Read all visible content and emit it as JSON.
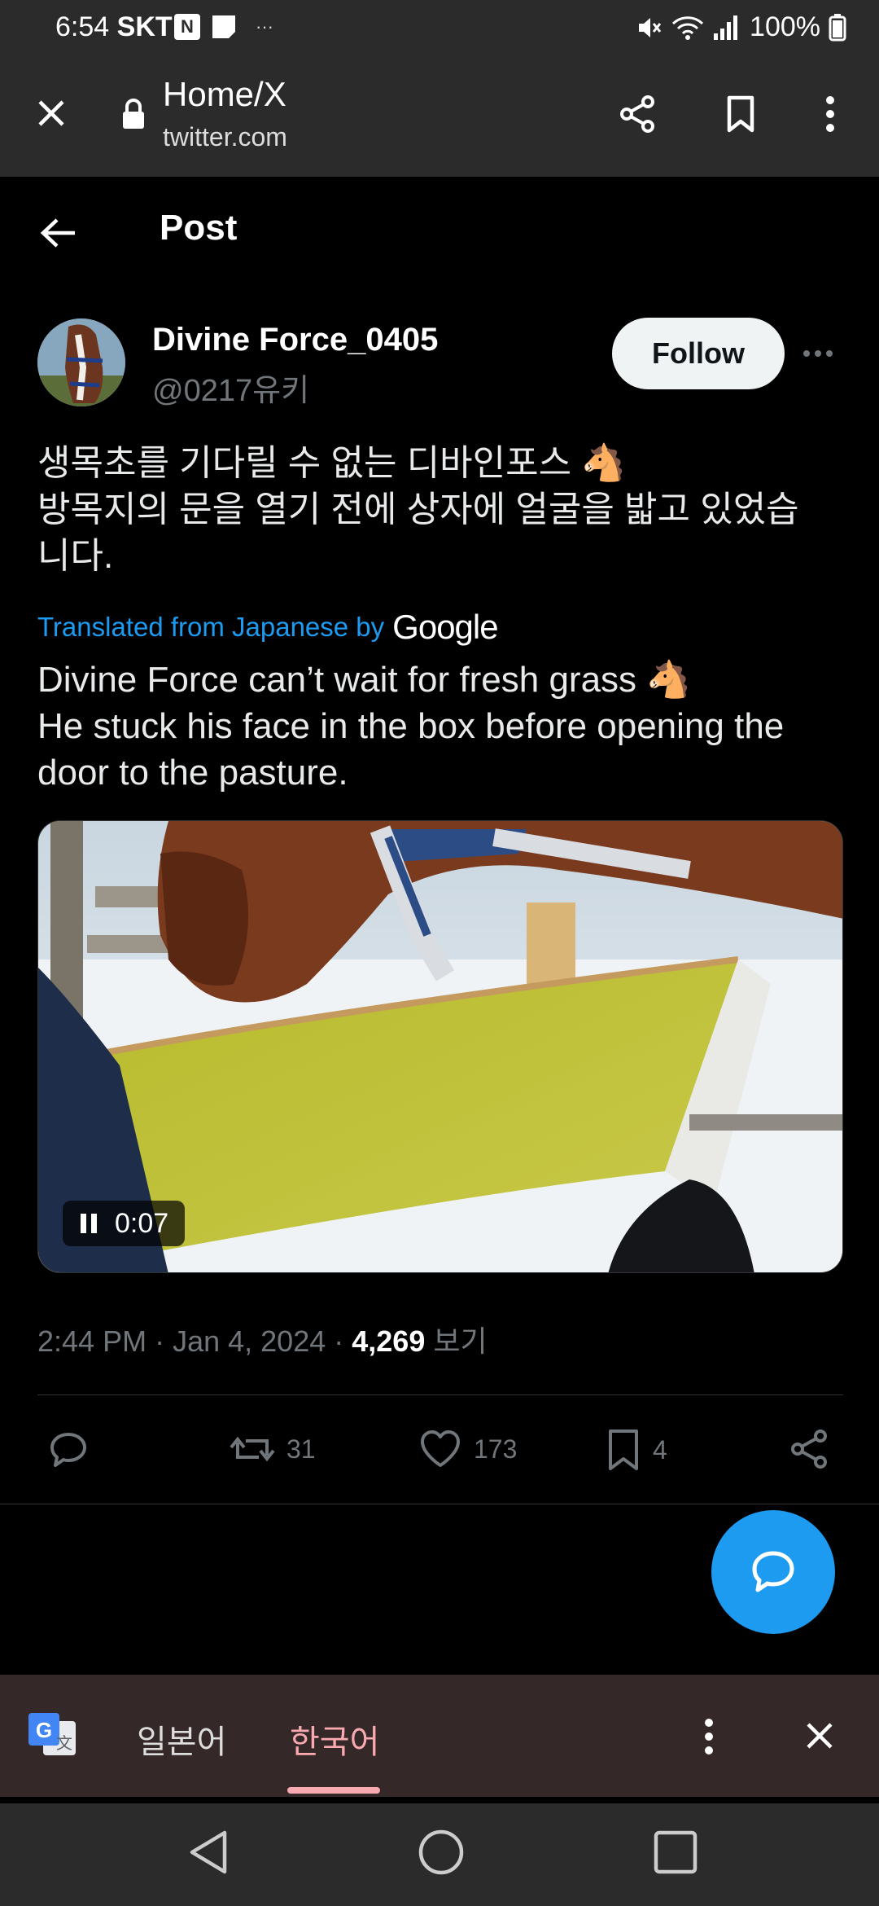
{
  "status": {
    "time": "6:54",
    "carrier": "SKT",
    "notif_icon_letter": "N",
    "battery": "100%"
  },
  "browser": {
    "title": "Home/X",
    "host": "twitter.com"
  },
  "header": {
    "title": "Post"
  },
  "author": {
    "name": "Divine Force_0405",
    "handle": "@0217유키",
    "follow_label": "Follow"
  },
  "tweet": {
    "text_lines": [
      "생목초를 기다릴 수 없는 디바인포스 🐴",
      "방목지의 문을 열기 전에 상자에 얼굴을 밟고 있었습",
      "니다."
    ],
    "translated_label": "Translated from Japanese by",
    "translated_provider": "Google",
    "translation_lines": [
      "Divine Force can’t wait for fresh grass 🐴",
      "He stuck his face in the box before opening the",
      "door to the pasture."
    ],
    "video_time": "0:07"
  },
  "meta": {
    "time": "2:44 PM",
    "date": "Jan 4, 2024",
    "views_count": "4,269",
    "views_label": "보기"
  },
  "actions": {
    "retweets": "31",
    "likes": "173",
    "bookmarks": "4"
  },
  "translate_bar": {
    "lang_source": "일본어",
    "lang_target": "한국어"
  },
  "colors": {
    "accent": "#1d9bf0",
    "background": "#000000",
    "toolbar": "#2b2b2b",
    "translate_bar": "#352829",
    "active_lang": "#f9a9b0",
    "muted": "#71767b"
  }
}
